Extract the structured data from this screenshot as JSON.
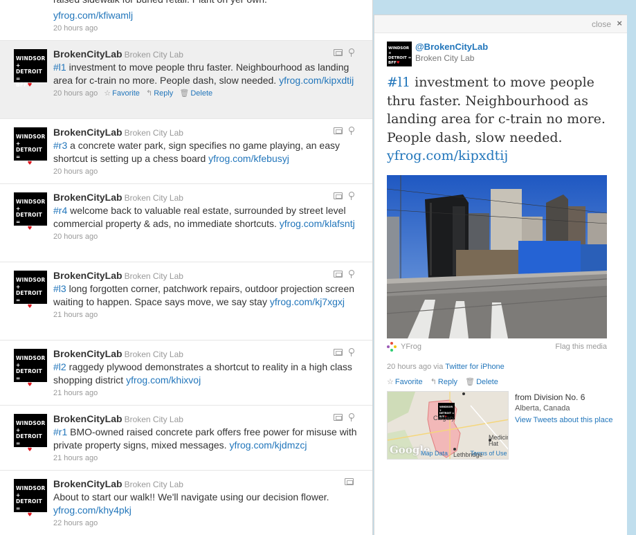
{
  "partial_tweet": {
    "text": "raised sidewalk for buried retail. Plant on yer own.",
    "link": "yfrog.com/kfiwamlj",
    "time": "20 hours ago"
  },
  "avatar": {
    "line1": "WINDSOR +",
    "line2": "DETROIT =",
    "line3": "BFF",
    "heart": "♥"
  },
  "actions": {
    "favorite": "Favorite",
    "reply": "Reply",
    "delete": "Delete"
  },
  "tweets": [
    {
      "name": "BrokenCityLab",
      "screen_name": "Broken City Lab",
      "hashtag": "#l1",
      "text": " investment to move people thru faster. Neighbourhood as landing area for c-train no more. People dash, slow needed. ",
      "link": "yfrog.com/kipxdtij",
      "time": "20 hours ago"
    },
    {
      "name": "BrokenCityLab",
      "screen_name": "Broken City Lab",
      "hashtag": "#r3",
      "text": " a concrete water park, sign specifies no game playing, an easy shortcut is setting up a chess board ",
      "link": "yfrog.com/kfebusyj",
      "time": "20 hours ago"
    },
    {
      "name": "BrokenCityLab",
      "screen_name": "Broken City Lab",
      "hashtag": "#r4",
      "text": " welcome back to valuable real estate, surrounded by street level commercial property & ads, no immediate shortcuts. ",
      "link": "yfrog.com/klafsntj",
      "time": "20 hours ago"
    },
    {
      "name": "BrokenCityLab",
      "screen_name": "Broken City Lab",
      "hashtag": "#l3",
      "text": " long forgotten corner, patchwork repairs, outdoor projection screen waiting to happen. Space says move, we say stay ",
      "link": "yfrog.com/kj7xgxj",
      "time": "21 hours ago"
    },
    {
      "name": "BrokenCityLab",
      "screen_name": "Broken City Lab",
      "hashtag": "#l2",
      "text": " raggedy plywood demonstrates a shortcut to reality in a high class shopping district ",
      "link": "yfrog.com/khixvoj",
      "time": "21 hours ago"
    },
    {
      "name": "BrokenCityLab",
      "screen_name": "Broken City Lab",
      "hashtag": "#r1",
      "text": " BMO-owned raised concrete park offers free power for misuse with private property signs, mixed messages. ",
      "link": "yfrog.com/kjdmzcj",
      "time": "21 hours ago"
    },
    {
      "name": "BrokenCityLab",
      "screen_name": "Broken City Lab",
      "hashtag": "",
      "text": "About to start our walk!! We'll navigate using our decision flower. ",
      "link": "yfrog.com/khy4pkj",
      "time": "22 hours ago"
    }
  ],
  "details": {
    "close_label": "close",
    "close_icon": "×",
    "handle": "@BrokenCityLab",
    "name": "Broken City Lab",
    "hashtag": "#l1",
    "text": " investment to move people thru faster. Neighbourhood as landing area for c-train no more. People dash, slow needed. ",
    "link": "yfrog.com/kipxdtij",
    "media_source": "YFrog",
    "flag_label": "Flag this media",
    "time_prefix": "20 hours ago via ",
    "via_app": "Twitter for iPhone",
    "map": {
      "google": "Google",
      "map_data": "Map Data",
      "terms": "Terms of Use",
      "city_calgary": "Calgary",
      "city_medicine_hat": "Medicine Hat",
      "city_lethbridge": "Lethbridge"
    },
    "place": {
      "from": "from Division No. 6",
      "region": "Alberta, Canada",
      "view_link": "View Tweets about this place"
    }
  },
  "colors": {
    "link": "#2276bb",
    "background": "#c0deed",
    "heart": "#e0161e"
  }
}
